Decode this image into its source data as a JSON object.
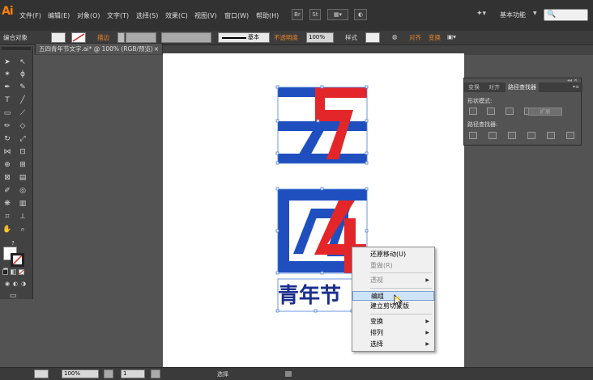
{
  "app": {
    "logo": "Ai",
    "menus": [
      "文件(F)",
      "编辑(E)",
      "对象(O)",
      "文字(T)",
      "选择(S)",
      "效果(C)",
      "视图(V)",
      "窗口(W)",
      "帮助(H)"
    ],
    "toolbar_buttons": [
      "Br",
      "St"
    ],
    "workspace": "基本功能",
    "search_placeholder": "🔍"
  },
  "control_bar": {
    "selection_label": "编合对象",
    "stroke_label": "描边",
    "stroke_style": "基本",
    "opacity_label": "不透明度",
    "opacity_value": "100%",
    "style_label": "样式",
    "align_label": "对齐",
    "transform_label": "变换"
  },
  "document": {
    "tab_title": "五四青年节文字.ai* @ 100% (RGB/预览)",
    "close": "×"
  },
  "artwork": {
    "bottom_text": "青年节",
    "colors": {
      "blue": "#1f4fbf",
      "red": "#e3262a"
    }
  },
  "panel": {
    "tabs": [
      "变换",
      "对齐",
      "路径查找器"
    ],
    "shape_modes_label": "形状模式:",
    "expand_label": "扩展",
    "pathfinders_label": "路径查找器:"
  },
  "context_menu": {
    "items": [
      {
        "label": "还原移动(U)",
        "disabled": false,
        "submenu": false
      },
      {
        "label": "重做(R)",
        "disabled": true,
        "submenu": false
      },
      {
        "label": "透视",
        "disabled": true,
        "submenu": true
      },
      {
        "label": "编组",
        "disabled": false,
        "submenu": false,
        "highlighted": true
      },
      {
        "label": "建立剪切蒙版",
        "disabled": false,
        "submenu": false
      },
      {
        "label": "变换",
        "disabled": false,
        "submenu": true
      },
      {
        "label": "排列",
        "disabled": false,
        "submenu": true
      },
      {
        "label": "选择",
        "disabled": false,
        "submenu": true
      }
    ]
  },
  "status_bar": {
    "zoom": "100%",
    "page": "1",
    "tool": "选择"
  }
}
